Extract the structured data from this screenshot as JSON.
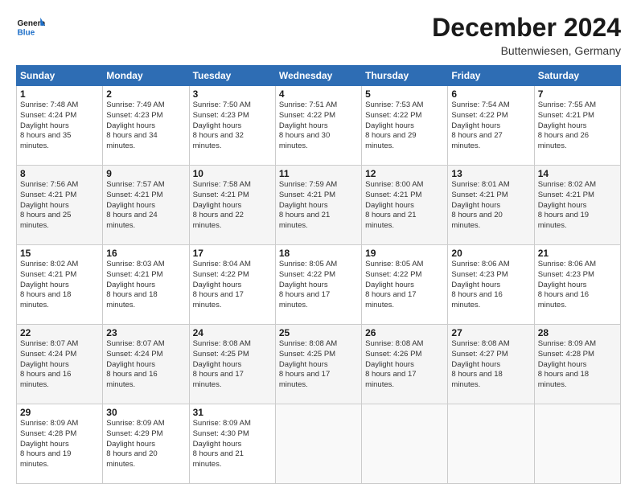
{
  "header": {
    "logo_general": "General",
    "logo_blue": "Blue",
    "month": "December 2024",
    "location": "Buttenwiesen, Germany"
  },
  "weekdays": [
    "Sunday",
    "Monday",
    "Tuesday",
    "Wednesday",
    "Thursday",
    "Friday",
    "Saturday"
  ],
  "weeks": [
    [
      {
        "day": "1",
        "sunrise": "7:48 AM",
        "sunset": "4:24 PM",
        "daylight": "8 hours and 35 minutes."
      },
      {
        "day": "2",
        "sunrise": "7:49 AM",
        "sunset": "4:23 PM",
        "daylight": "8 hours and 34 minutes."
      },
      {
        "day": "3",
        "sunrise": "7:50 AM",
        "sunset": "4:23 PM",
        "daylight": "8 hours and 32 minutes."
      },
      {
        "day": "4",
        "sunrise": "7:51 AM",
        "sunset": "4:22 PM",
        "daylight": "8 hours and 30 minutes."
      },
      {
        "day": "5",
        "sunrise": "7:53 AM",
        "sunset": "4:22 PM",
        "daylight": "8 hours and 29 minutes."
      },
      {
        "day": "6",
        "sunrise": "7:54 AM",
        "sunset": "4:22 PM",
        "daylight": "8 hours and 27 minutes."
      },
      {
        "day": "7",
        "sunrise": "7:55 AM",
        "sunset": "4:21 PM",
        "daylight": "8 hours and 26 minutes."
      }
    ],
    [
      {
        "day": "8",
        "sunrise": "7:56 AM",
        "sunset": "4:21 PM",
        "daylight": "8 hours and 25 minutes."
      },
      {
        "day": "9",
        "sunrise": "7:57 AM",
        "sunset": "4:21 PM",
        "daylight": "8 hours and 24 minutes."
      },
      {
        "day": "10",
        "sunrise": "7:58 AM",
        "sunset": "4:21 PM",
        "daylight": "8 hours and 22 minutes."
      },
      {
        "day": "11",
        "sunrise": "7:59 AM",
        "sunset": "4:21 PM",
        "daylight": "8 hours and 21 minutes."
      },
      {
        "day": "12",
        "sunrise": "8:00 AM",
        "sunset": "4:21 PM",
        "daylight": "8 hours and 21 minutes."
      },
      {
        "day": "13",
        "sunrise": "8:01 AM",
        "sunset": "4:21 PM",
        "daylight": "8 hours and 20 minutes."
      },
      {
        "day": "14",
        "sunrise": "8:02 AM",
        "sunset": "4:21 PM",
        "daylight": "8 hours and 19 minutes."
      }
    ],
    [
      {
        "day": "15",
        "sunrise": "8:02 AM",
        "sunset": "4:21 PM",
        "daylight": "8 hours and 18 minutes."
      },
      {
        "day": "16",
        "sunrise": "8:03 AM",
        "sunset": "4:21 PM",
        "daylight": "8 hours and 18 minutes."
      },
      {
        "day": "17",
        "sunrise": "8:04 AM",
        "sunset": "4:22 PM",
        "daylight": "8 hours and 17 minutes."
      },
      {
        "day": "18",
        "sunrise": "8:05 AM",
        "sunset": "4:22 PM",
        "daylight": "8 hours and 17 minutes."
      },
      {
        "day": "19",
        "sunrise": "8:05 AM",
        "sunset": "4:22 PM",
        "daylight": "8 hours and 17 minutes."
      },
      {
        "day": "20",
        "sunrise": "8:06 AM",
        "sunset": "4:23 PM",
        "daylight": "8 hours and 16 minutes."
      },
      {
        "day": "21",
        "sunrise": "8:06 AM",
        "sunset": "4:23 PM",
        "daylight": "8 hours and 16 minutes."
      }
    ],
    [
      {
        "day": "22",
        "sunrise": "8:07 AM",
        "sunset": "4:24 PM",
        "daylight": "8 hours and 16 minutes."
      },
      {
        "day": "23",
        "sunrise": "8:07 AM",
        "sunset": "4:24 PM",
        "daylight": "8 hours and 16 minutes."
      },
      {
        "day": "24",
        "sunrise": "8:08 AM",
        "sunset": "4:25 PM",
        "daylight": "8 hours and 17 minutes."
      },
      {
        "day": "25",
        "sunrise": "8:08 AM",
        "sunset": "4:25 PM",
        "daylight": "8 hours and 17 minutes."
      },
      {
        "day": "26",
        "sunrise": "8:08 AM",
        "sunset": "4:26 PM",
        "daylight": "8 hours and 17 minutes."
      },
      {
        "day": "27",
        "sunrise": "8:08 AM",
        "sunset": "4:27 PM",
        "daylight": "8 hours and 18 minutes."
      },
      {
        "day": "28",
        "sunrise": "8:09 AM",
        "sunset": "4:28 PM",
        "daylight": "8 hours and 18 minutes."
      }
    ],
    [
      {
        "day": "29",
        "sunrise": "8:09 AM",
        "sunset": "4:28 PM",
        "daylight": "8 hours and 19 minutes."
      },
      {
        "day": "30",
        "sunrise": "8:09 AM",
        "sunset": "4:29 PM",
        "daylight": "8 hours and 20 minutes."
      },
      {
        "day": "31",
        "sunrise": "8:09 AM",
        "sunset": "4:30 PM",
        "daylight": "8 hours and 21 minutes."
      },
      null,
      null,
      null,
      null
    ]
  ]
}
